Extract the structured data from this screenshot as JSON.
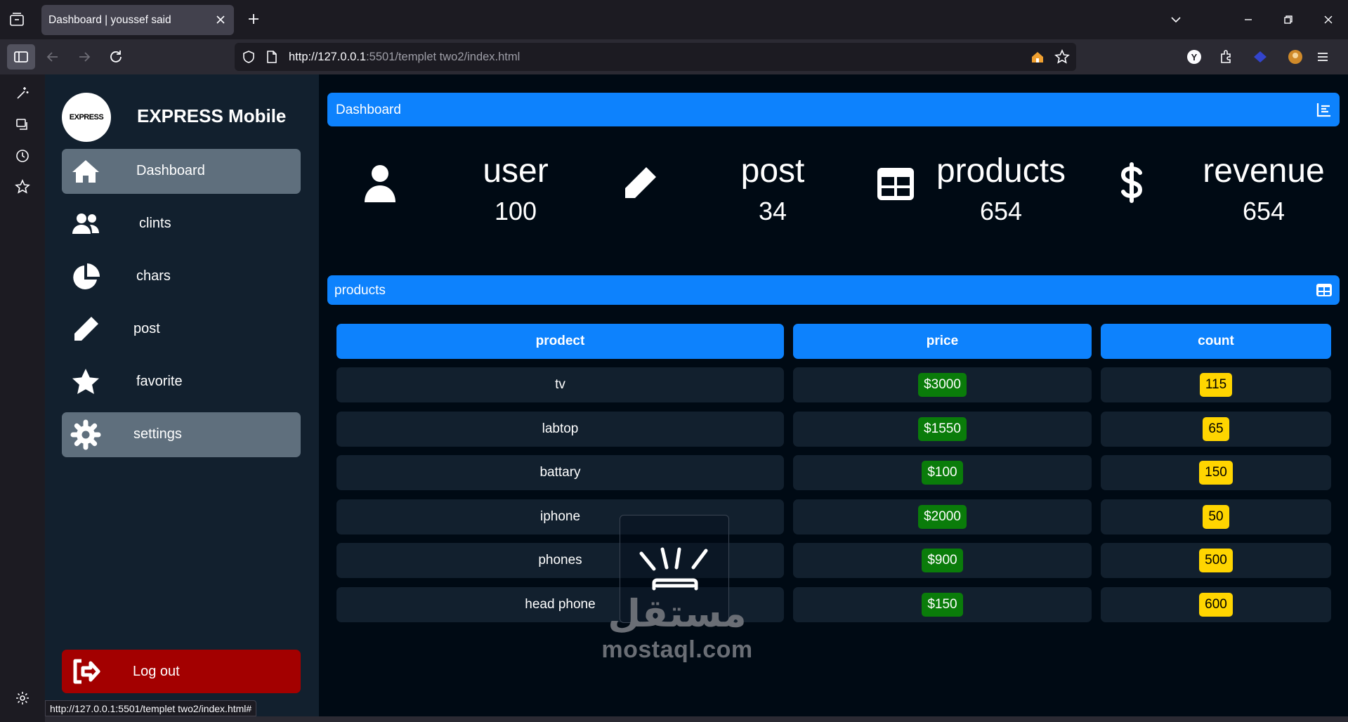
{
  "browser": {
    "tab_title": "Dashboard | youssef said",
    "url_host": "http://127.0.0.1",
    "url_rest": ":5501/templet two2/index.html",
    "status_url": "http://127.0.0.1:5501/templet two2/index.html#"
  },
  "sidebar": {
    "brand_logo_text": "EXPRESS",
    "brand_name": "EXPRESS Mobile",
    "items": [
      {
        "label": "Dashboard",
        "icon": "home-icon",
        "active": true
      },
      {
        "label": "clints",
        "icon": "users-icon",
        "active": false
      },
      {
        "label": "chars",
        "icon": "pie-chart-icon",
        "active": false
      },
      {
        "label": "post",
        "icon": "pencil-icon",
        "active": false
      },
      {
        "label": "favorite",
        "icon": "star-icon",
        "active": false
      },
      {
        "label": "settings",
        "icon": "gear-icon",
        "active": true
      }
    ],
    "logout_label": "Log out"
  },
  "dashboard": {
    "title": "Dashboard",
    "stats": [
      {
        "label": "user",
        "value": "100",
        "icon": "user-icon"
      },
      {
        "label": "post",
        "value": "34",
        "icon": "pencil-icon"
      },
      {
        "label": "products",
        "value": "654",
        "icon": "table-icon"
      },
      {
        "label": "revenue",
        "value": "654",
        "icon": "dollar-icon"
      }
    ]
  },
  "products": {
    "title": "products",
    "columns": [
      "prodect",
      "price",
      "count"
    ],
    "rows": [
      {
        "name": "tv",
        "price": "$3000",
        "count": "115"
      },
      {
        "name": "labtop",
        "price": "$1550",
        "count": "65"
      },
      {
        "name": "battary",
        "price": "$100",
        "count": "150"
      },
      {
        "name": "iphone",
        "price": "$2000",
        "count": "50"
      },
      {
        "name": "phones",
        "price": "$900",
        "count": "500"
      },
      {
        "name": "head phone",
        "price": "$150",
        "count": "600"
      }
    ]
  },
  "watermark": {
    "latin": "mostaql.com",
    "arabic": "مستقل"
  },
  "colors": {
    "accent": "#0d82fd",
    "price_badge": "#0a7c0a",
    "count_badge": "#ffd500",
    "logout": "#a30000"
  }
}
